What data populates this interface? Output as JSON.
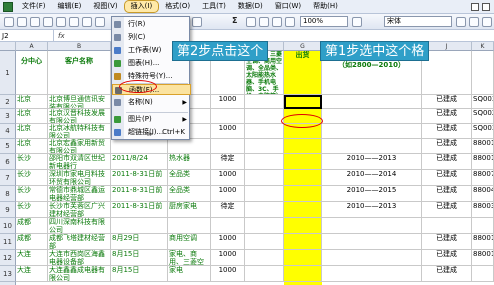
{
  "menubar": {
    "items": [
      "文件(F)",
      "编辑(E)",
      "视图(V)",
      "插入(I)",
      "格式(O)",
      "工具(T)",
      "数据(D)",
      "窗口(W)",
      "帮助(H)"
    ]
  },
  "toolbar": {
    "zoom": "100%",
    "font": "宋体"
  },
  "formula_bar": {
    "name_box": "J2",
    "fx": "fx"
  },
  "columns": [
    "A",
    "B",
    "C",
    "D",
    "E",
    "F",
    "G",
    "H",
    "I",
    "J",
    "K",
    "L"
  ],
  "rows": [
    "1",
    "2",
    "3",
    "4",
    "5",
    "6",
    "7",
    "8",
    "9",
    "10",
    "11",
    "12",
    "13",
    "14"
  ],
  "headers": {
    "a": "分中心",
    "b": "客户名称",
    "f": "（家电、三菱空调、商用空调、全品类、太阳能热水器、手机电脑、3C、手机、电脑等）",
    "g": "出货",
    "h": "（如2800—2010）"
  },
  "table": [
    {
      "a": "北京",
      "b": "北京博旦通信讯安装有限公司",
      "c": "",
      "e": "1000",
      "i": "已建成",
      "j": "SQ003"
    },
    {
      "a": "北京",
      "b": "北京汉晋科技发展有限公司",
      "c": "",
      "e": "",
      "i": "已建成",
      "j": "SQ002"
    },
    {
      "a": "北京",
      "b": "北京冰航特科技有限公司",
      "c": "2011/8/18",
      "e": "1000",
      "i": "已建成",
      "j": "SQ003"
    },
    {
      "a": "北京",
      "b": "北京宏鑫家用新贸有限公司",
      "c": "",
      "e": "",
      "i": "已建成",
      "j": "88001"
    },
    {
      "a": "长沙",
      "b": "邵阳市双清区世纪新电器行",
      "c": "2011/8/24",
      "d": "热水器",
      "e": "待定",
      "h": "2010——2013",
      "i": "已建成",
      "j": "88001"
    },
    {
      "a": "长沙",
      "b": "深圳市家电月料技环贸有限公司",
      "c": "2011-8-31日前",
      "d": "全品类",
      "e": "1000",
      "h": "2010——2014",
      "i": "已建成",
      "j": "88007"
    },
    {
      "a": "长沙",
      "b": "常德市鼎城区鑫运电器经营部",
      "c": "2011-8-31日前",
      "d": "全品类",
      "e": "1000",
      "h": "2010——2015",
      "i": "已建成",
      "j": "88004"
    },
    {
      "a": "长沙",
      "b": "长沙市芙蓉区广兴建材经营部",
      "c": "2011-8-31日前",
      "d": "厨房家电",
      "e": "待定",
      "h": "2010——2013",
      "i": "已建成",
      "j": "88003"
    },
    {
      "a": "成都",
      "b": "四川深南科技有限公司",
      "c": "",
      "e": "",
      "i": "",
      "j": ""
    },
    {
      "a": "成都",
      "b": "成都飞塔建材经营部",
      "c": "8月29日",
      "d": "商用空调",
      "e": "1000",
      "i": "已建成",
      "j": "88001"
    },
    {
      "a": "大连",
      "b": "大连市西岗区海鑫电器设备部",
      "c": "8月15日",
      "d": "家电、商用、三菱空调",
      "e": "1000",
      "i": "已建成",
      "j": "88001"
    },
    {
      "a": "大连",
      "b": "大连鑫鑫成电器有限公司",
      "c": "8月15日",
      "d": "家电",
      "e": "1000",
      "i": "已建成",
      "j": ""
    }
  ],
  "dropdown": {
    "items": [
      {
        "label": "行(R)",
        "icon": "rows-icon"
      },
      {
        "label": "列(C)",
        "icon": "columns-icon"
      },
      {
        "label": "工作表(W)",
        "icon": "worksheet-icon"
      },
      {
        "label": "图表(H)...",
        "icon": "chart-icon"
      },
      {
        "label": "特殊符号(Y)...",
        "icon": "symbol-icon"
      },
      {
        "label": "函数(F)...",
        "icon": "function-icon"
      },
      {
        "label": "名称(N)",
        "icon": "name-icon",
        "submenu": true
      },
      {
        "label": "图片(P)",
        "icon": "picture-icon",
        "submenu": true
      },
      {
        "label": "超链接(I)...",
        "icon": "hyperlink-icon",
        "shortcut": "Ctrl+K"
      }
    ],
    "more": "≫"
  },
  "callouts": {
    "step2": "第2步点击这个",
    "step1": "第1步选中这个格"
  },
  "colors": {
    "callout": "#2f9fc8",
    "highlight_col": "#ffff00",
    "menu_highlight": "#fbe3a0",
    "annotation": "#e00000",
    "text_green": "#0b7a0b"
  }
}
